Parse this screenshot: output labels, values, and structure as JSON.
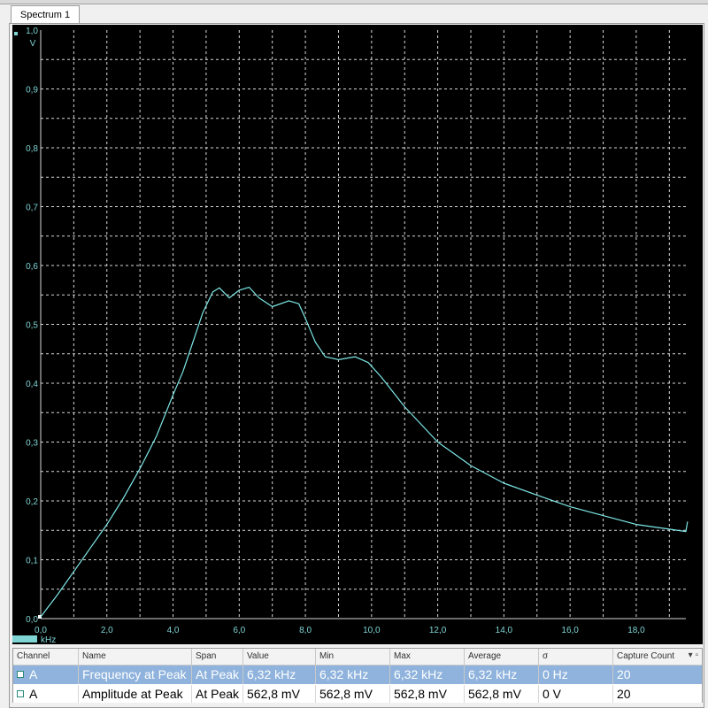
{
  "window": {
    "tab_label": "Spectrum 1"
  },
  "chart_data": {
    "type": "line",
    "xlabel": "kHz",
    "ylabel": "V",
    "xlim": [
      0,
      19.5
    ],
    "ylim": [
      0,
      1.0
    ],
    "x_ticks": [
      "0,0",
      "2,0",
      "4,0",
      "6,0",
      "8,0",
      "10,0",
      "12,0",
      "14,0",
      "16,0",
      "18,0"
    ],
    "y_ticks": [
      "0,0",
      "0,1",
      "0,2",
      "0,3",
      "0,4",
      "0,5",
      "0,6",
      "0,7",
      "0,8",
      "0,9",
      "1,0"
    ],
    "grid": true,
    "colors": {
      "background": "#000000",
      "trace": "#7fe7e7",
      "axis_text": "#7fd4d4",
      "grid": "#d8d8d8"
    },
    "series": [
      {
        "x": [
          0.0,
          0.5,
          1.0,
          1.5,
          2.0,
          2.5,
          3.0,
          3.5,
          4.0,
          4.3,
          4.6,
          4.9,
          5.2,
          5.4,
          5.7,
          6.0,
          6.3,
          6.6,
          7.0,
          7.5,
          7.8,
          8.0,
          8.3,
          8.6,
          9.0,
          9.5,
          9.9,
          10.3,
          11.0,
          12.0,
          13.0,
          14.0,
          15.0,
          16.0,
          17.0,
          18.0,
          19.0,
          19.5,
          19.55
        ],
        "values": [
          0.003,
          0.04,
          0.08,
          0.12,
          0.16,
          0.205,
          0.255,
          0.31,
          0.38,
          0.42,
          0.47,
          0.52,
          0.555,
          0.562,
          0.545,
          0.558,
          0.563,
          0.545,
          0.53,
          0.54,
          0.535,
          0.51,
          0.47,
          0.445,
          0.44,
          0.445,
          0.435,
          0.41,
          0.36,
          0.3,
          0.26,
          0.23,
          0.21,
          0.19,
          0.175,
          0.16,
          0.152,
          0.148,
          0.165
        ]
      }
    ]
  },
  "measurements": {
    "columns": [
      "Channel",
      "Name",
      "Span",
      "Value",
      "Min",
      "Max",
      "Average",
      "σ",
      "Capture Count"
    ],
    "rows": [
      [
        "A",
        "Frequency at Peak",
        "At Peak",
        "6,32 kHz",
        "6,32 kHz",
        "6,32 kHz",
        "6,32 kHz",
        "0 Hz",
        "20"
      ],
      [
        "A",
        "Amplitude at Peak",
        "At Peak",
        "562,8 mV",
        "562,8 mV",
        "562,8 mV",
        "562,8 mV",
        "0 V",
        "20"
      ]
    ],
    "header_buttons": "▾ ▫"
  }
}
